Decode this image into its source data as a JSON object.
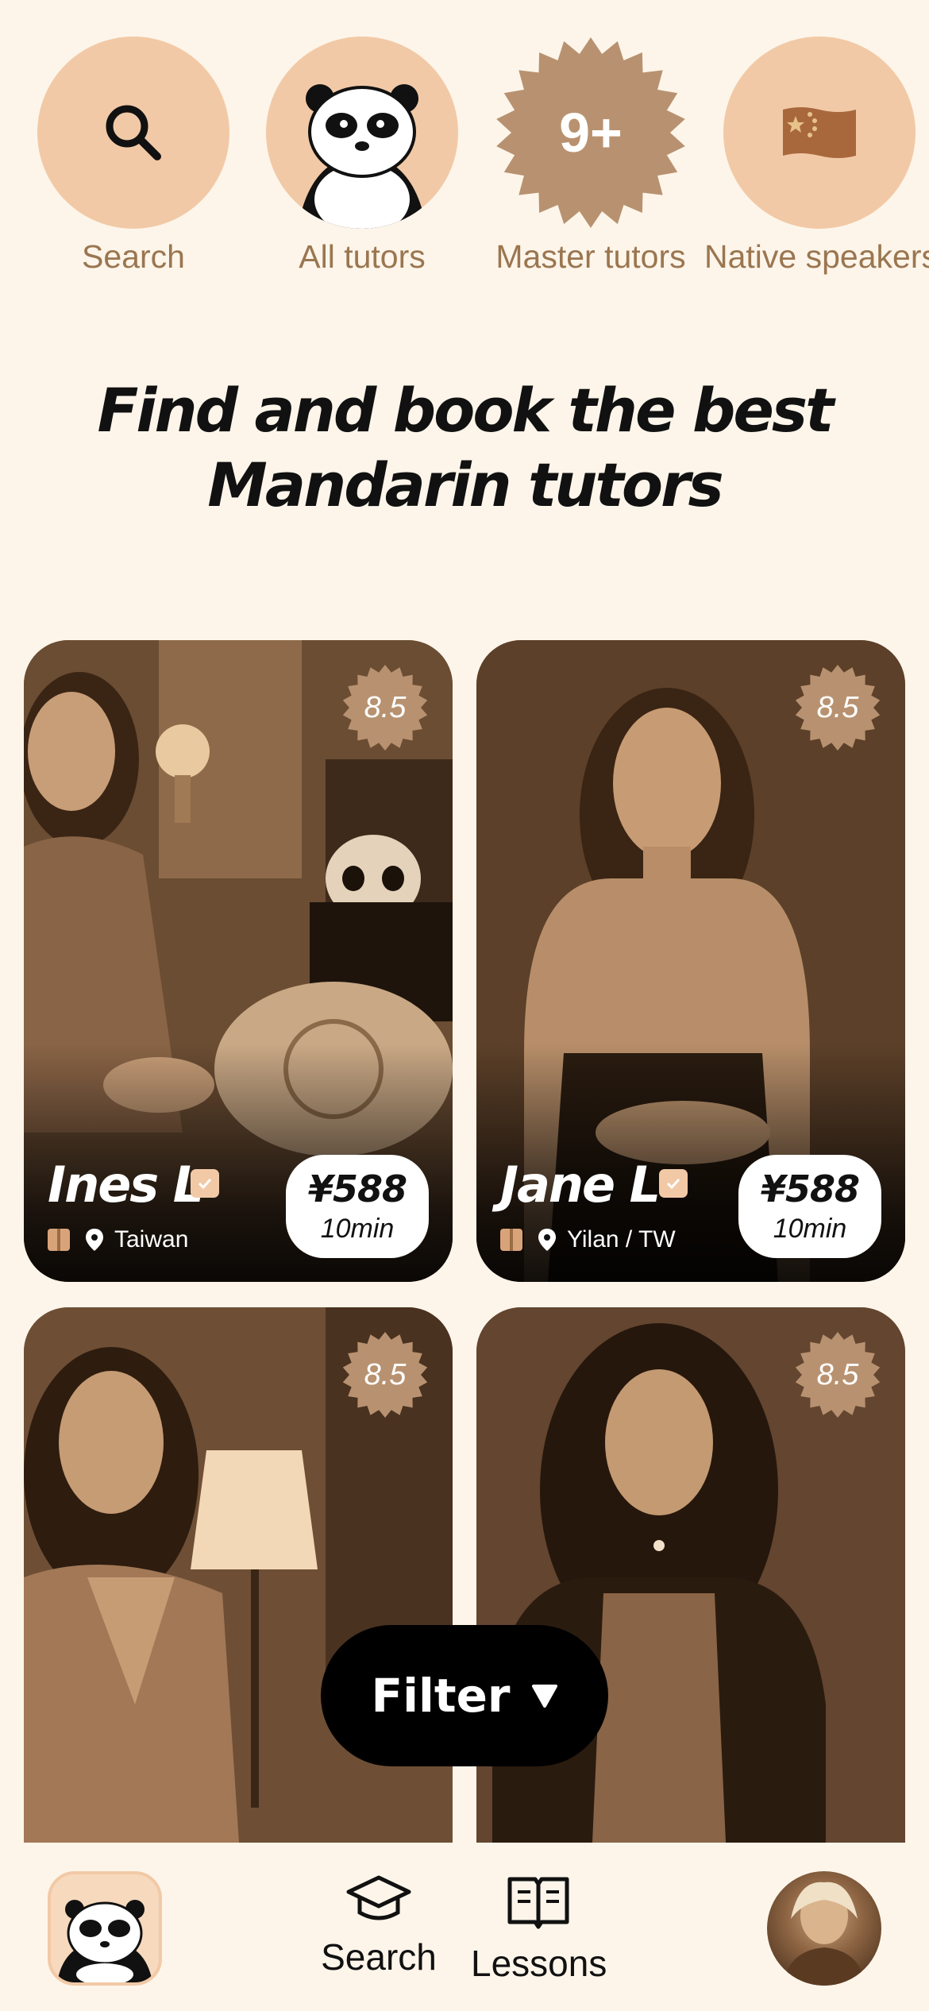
{
  "categories": [
    {
      "label": "Search",
      "icon": "search-icon"
    },
    {
      "label": "All tutors",
      "icon": "panda-icon"
    },
    {
      "label": "Master tutors",
      "badge": "9+"
    },
    {
      "label": "Native speakers",
      "icon": "china-flag-icon"
    }
  ],
  "headline": {
    "line1": "Find and book the best",
    "line2": "Mandarin tutors"
  },
  "tutors": [
    {
      "name": "Ines L",
      "rating": "8.5",
      "location": "Taiwan",
      "price": "¥588",
      "duration": "10min"
    },
    {
      "name": "Jane L",
      "rating": "8.5",
      "location": "Yilan / TW",
      "price": "¥588",
      "duration": "10min"
    },
    {
      "name": "",
      "rating": "8.5",
      "location": "",
      "price": "",
      "duration": ""
    },
    {
      "name": "",
      "rating": "8.5",
      "location": "",
      "price": "",
      "duration": ""
    }
  ],
  "filter": {
    "label": "Filter"
  },
  "nav": {
    "search_label": "Search",
    "lessons_label": "Lessons"
  },
  "colors": {
    "background": "#fdf5ea",
    "accent_peach": "#f2c9a6",
    "badge_brown": "#b89270",
    "label_brown": "#9a7650"
  }
}
